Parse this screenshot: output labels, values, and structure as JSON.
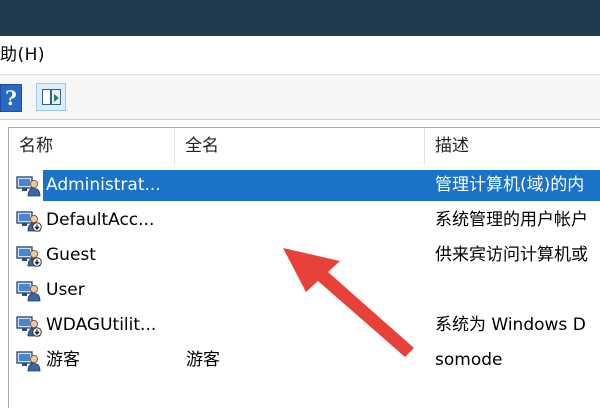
{
  "menu": {
    "help_label": "助(H)"
  },
  "toolbar": {
    "help_icon": "help-icon",
    "view_icon": "show-hide-console-tree-icon",
    "help_glyph": "?"
  },
  "list": {
    "columns": [
      "名称",
      "全名",
      "描述"
    ],
    "rows": [
      {
        "name": "Administrat...",
        "fullname": "",
        "desc": "管理计算机(域)的内",
        "selected": true,
        "icon": "user-icon"
      },
      {
        "name": "DefaultAcc...",
        "fullname": "",
        "desc": "系统管理的用户帐户",
        "selected": false,
        "icon": "disabled-user-icon"
      },
      {
        "name": "Guest",
        "fullname": "",
        "desc": "供来宾访问计算机或",
        "selected": false,
        "icon": "disabled-user-icon"
      },
      {
        "name": "User",
        "fullname": "",
        "desc": "",
        "selected": false,
        "icon": "user-icon"
      },
      {
        "name": "WDAGUtilit...",
        "fullname": "",
        "desc": "系统为 Windows D",
        "selected": false,
        "icon": "disabled-user-icon"
      },
      {
        "name": "游客",
        "fullname": "游客",
        "desc": "somode",
        "selected": false,
        "icon": "user-icon"
      }
    ]
  },
  "colors": {
    "selection": "#1a72c9",
    "titlebar": "#1f3a4d",
    "arrow": "#e8413a"
  }
}
